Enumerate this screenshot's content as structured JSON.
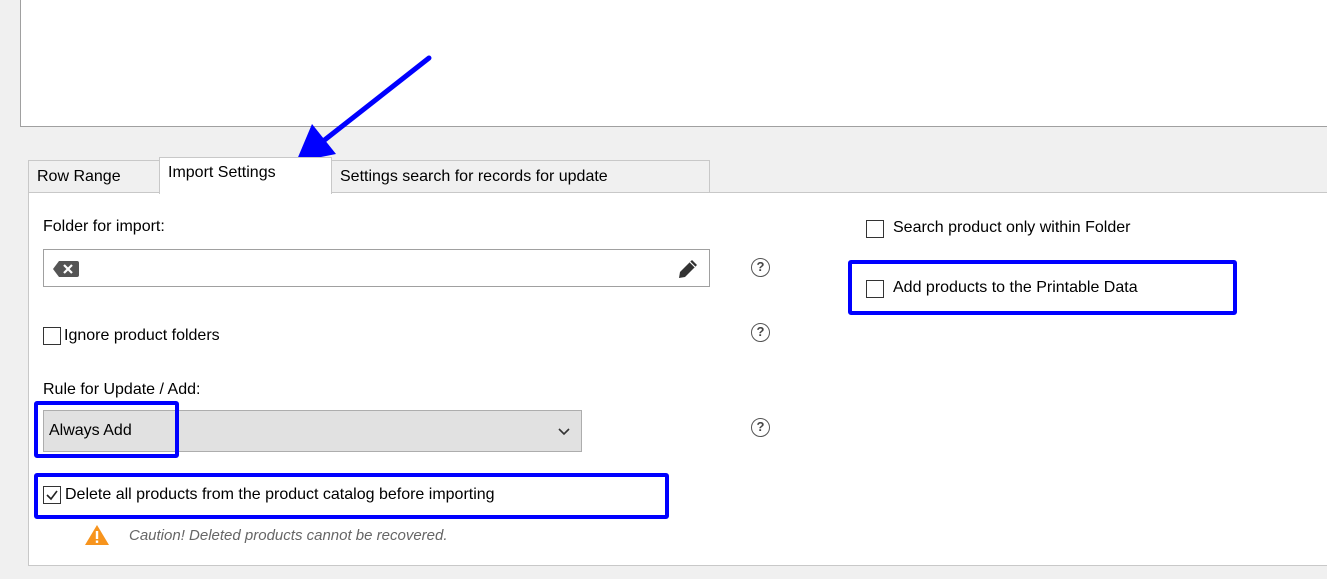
{
  "tabs": [
    {
      "label": "Row Range",
      "active": false
    },
    {
      "label": "Import Settings",
      "active": true
    },
    {
      "label": "Settings search for records for update",
      "active": false
    }
  ],
  "folder": {
    "label": "Folder for import:",
    "value": "",
    "clear_icon": "clear-icon",
    "edit_icon": "pencil-icon"
  },
  "ignore_folders": {
    "label": "Ignore product folders",
    "checked": false
  },
  "rule": {
    "label": "Rule for Update / Add:",
    "selected": "Always Add"
  },
  "delete_all": {
    "label": "Delete all products from the product catalog before importing",
    "checked": true
  },
  "caution": "Caution! Deleted products cannot be recovered.",
  "search_within_folder": {
    "label": "Search product only within Folder",
    "checked": false
  },
  "add_printable": {
    "label": "Add products to the Printable Data",
    "checked": false
  },
  "help_glyph": "?",
  "colors": {
    "highlight": "#0000ff",
    "warning": "#f7941d"
  }
}
